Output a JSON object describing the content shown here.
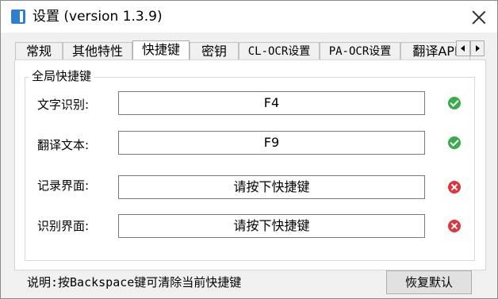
{
  "window": {
    "title": "设置 (version 1.3.9)"
  },
  "tabs": [
    {
      "label": "常规",
      "active": false
    },
    {
      "label": "其他特性",
      "active": false
    },
    {
      "label": "快捷键",
      "active": true
    },
    {
      "label": "密钥",
      "active": false
    },
    {
      "label": "CL-OCR设置",
      "active": false
    },
    {
      "label": "PA-OCR设置",
      "active": false
    },
    {
      "label": "翻译API",
      "active": false
    }
  ],
  "hotkeys": {
    "group_title": "全局快捷键",
    "rows": [
      {
        "label": "文字识别:",
        "value": "F4",
        "status": "ok"
      },
      {
        "label": "翻译文本:",
        "value": "F9",
        "status": "ok"
      },
      {
        "label": "记录界面:",
        "value": "请按下快捷键",
        "status": "error"
      },
      {
        "label": "识别界面:",
        "value": "请按下快捷键",
        "status": "error"
      }
    ]
  },
  "footer": {
    "note": "说明:按Backspace键可清除当前快捷键",
    "reset_label": "恢复默认"
  },
  "icons": {
    "ok": "check-circle-icon",
    "error": "x-circle-icon",
    "ok_color": "#3aab4a",
    "error_color": "#e0353f"
  }
}
